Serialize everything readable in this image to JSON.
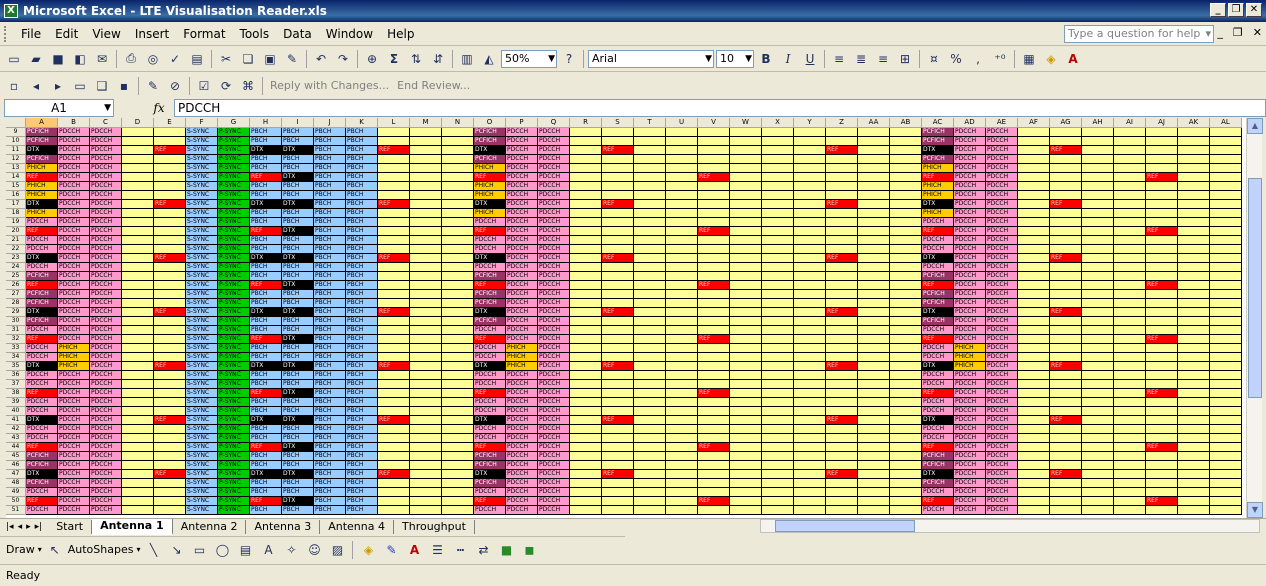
{
  "window": {
    "title": "Microsoft Excel - LTE Visualisation Reader.xls",
    "app_icon": "X",
    "minimize": "_",
    "restore": "❐",
    "close": "✕"
  },
  "menu": {
    "items": [
      "File",
      "Edit",
      "View",
      "Insert",
      "Format",
      "Tools",
      "Data",
      "Window",
      "Help"
    ],
    "help_placeholder": "Type a question for help",
    "doc_minimize": "_",
    "doc_restore": "❐",
    "doc_close": "✕"
  },
  "toolbar": {
    "zoom": "50%",
    "font": "Arial",
    "font_size": "10",
    "bold": "B",
    "italic": "I",
    "underline": "U",
    "sum_symbol": "Σ",
    "percent": "%",
    "comma": ",",
    "reply_changes": "Reply with Changes...",
    "end_review": "End Review..."
  },
  "formula_bar": {
    "name_box": "A1",
    "fx": "fx",
    "content": "PDCCH"
  },
  "columns": [
    "A",
    "B",
    "C",
    "D",
    "E",
    "F",
    "G",
    "H",
    "I",
    "J",
    "K",
    "L",
    "M",
    "N",
    "O",
    "P",
    "Q",
    "R",
    "S",
    "T",
    "U",
    "V",
    "W",
    "X",
    "Y",
    "Z",
    "AA",
    "AB",
    "AC",
    "AD",
    "AE",
    "AF",
    "AG",
    "AH",
    "AI",
    "AJ",
    "AK",
    "AL"
  ],
  "selected_column": "A",
  "rows": [
    {
      "n": "9",
      "a": "PCFICH",
      "h": "PBCH",
      "i": "PBCH"
    },
    {
      "n": "10",
      "a": "PCFICH",
      "h": "PBCH",
      "i": "PBCH"
    },
    {
      "n": "11",
      "a": "DTX",
      "h": "DTX",
      "i": "DTX",
      "ref": [
        "E",
        "L",
        "S",
        "Z",
        "AG"
      ]
    },
    {
      "n": "12",
      "a": "PCFICH",
      "h": "PBCH",
      "i": "PBCH"
    },
    {
      "n": "13",
      "a": "PHICH",
      "h": "PBCH",
      "i": "PBCH"
    },
    {
      "n": "14",
      "a": "REF",
      "h": "REF",
      "i": "DTX",
      "ref": [
        "V",
        "AJ"
      ]
    },
    {
      "n": "15",
      "a": "PHICH",
      "h": "PBCH",
      "i": "PBCH"
    },
    {
      "n": "16",
      "a": "PHICH",
      "h": "PBCH",
      "i": "PBCH"
    },
    {
      "n": "17",
      "a": "DTX",
      "h": "DTX",
      "i": "DTX",
      "ref": [
        "E",
        "L",
        "S",
        "Z",
        "AG"
      ]
    },
    {
      "n": "18",
      "a": "PHICH",
      "h": "PBCH",
      "i": "PBCH"
    },
    {
      "n": "19",
      "a": "PDCCH",
      "h": "PBCH",
      "i": "PBCH"
    },
    {
      "n": "20",
      "a": "REF",
      "h": "REF",
      "i": "DTX",
      "ref": [
        "V",
        "AJ"
      ]
    },
    {
      "n": "21",
      "a": "PDCCH",
      "h": "PBCH",
      "i": "PBCH"
    },
    {
      "n": "22",
      "a": "PDCCH",
      "h": "PBCH",
      "i": "PBCH"
    },
    {
      "n": "23",
      "a": "DTX",
      "h": "DTX",
      "i": "DTX",
      "ref": [
        "E",
        "L",
        "S",
        "Z",
        "AG"
      ]
    },
    {
      "n": "24",
      "a": "PDCCH",
      "h": "PBCH",
      "i": "PBCH"
    },
    {
      "n": "25",
      "a": "PCFICH",
      "h": "PBCH",
      "i": "PBCH"
    },
    {
      "n": "26",
      "a": "REF",
      "h": "REF",
      "i": "DTX",
      "ref": [
        "V",
        "AJ"
      ]
    },
    {
      "n": "27",
      "a": "PCFICH",
      "h": "PBCH",
      "i": "PBCH"
    },
    {
      "n": "28",
      "a": "PCFICH",
      "h": "PBCH",
      "i": "PBCH"
    },
    {
      "n": "29",
      "a": "DTX",
      "h": "DTX",
      "i": "DTX",
      "ref": [
        "E",
        "L",
        "S",
        "Z",
        "AG"
      ]
    },
    {
      "n": "30",
      "a": "PCFICH",
      "h": "PBCH",
      "i": "PBCH"
    },
    {
      "n": "31",
      "a": "PDCCH",
      "h": "PBCH",
      "i": "PBCH"
    },
    {
      "n": "32",
      "a": "REF",
      "h": "REF",
      "i": "DTX",
      "ref": [
        "V",
        "AJ"
      ]
    },
    {
      "n": "33",
      "a": "PDCCH",
      "b": "PHICH",
      "h": "PBCH",
      "i": "PBCH"
    },
    {
      "n": "34",
      "a": "PDCCH",
      "b": "PHICH",
      "h": "PBCH",
      "i": "PBCH"
    },
    {
      "n": "35",
      "a": "DTX",
      "b": "PHICH",
      "h": "DTX",
      "i": "DTX",
      "ref": [
        "E",
        "L",
        "S",
        "Z",
        "AG"
      ]
    },
    {
      "n": "36",
      "a": "PDCCH",
      "h": "PBCH",
      "i": "PBCH"
    },
    {
      "n": "37",
      "a": "PDCCH",
      "h": "PBCH",
      "i": "PBCH"
    },
    {
      "n": "38",
      "a": "REF",
      "h": "REF",
      "i": "DTX",
      "ref": [
        "V",
        "AJ"
      ]
    },
    {
      "n": "39",
      "a": "PDCCH",
      "h": "PBCH",
      "i": "PBCH"
    },
    {
      "n": "40",
      "a": "PDCCH",
      "h": "PBCH",
      "i": "PBCH"
    },
    {
      "n": "41",
      "a": "DTX",
      "h": "DTX",
      "i": "DTX",
      "ref": [
        "E",
        "L",
        "S",
        "Z",
        "AG"
      ]
    },
    {
      "n": "42",
      "a": "PDCCH",
      "h": "PBCH",
      "i": "PBCH"
    },
    {
      "n": "43",
      "a": "PDCCH",
      "h": "PBCH",
      "i": "PBCH"
    },
    {
      "n": "44",
      "a": "REF",
      "h": "REF",
      "i": "DTX",
      "ref": [
        "V",
        "AJ"
      ]
    },
    {
      "n": "45",
      "a": "PCFICH",
      "h": "PBCH",
      "i": "PBCH"
    },
    {
      "n": "46",
      "a": "PCFICH",
      "h": "PBCH",
      "i": "PBCH"
    },
    {
      "n": "47",
      "a": "DTX",
      "h": "DTX",
      "i": "DTX",
      "ref": [
        "E",
        "L",
        "S",
        "Z",
        "AG"
      ]
    },
    {
      "n": "48",
      "a": "PCFICH",
      "h": "PBCH",
      "i": "PBCH"
    },
    {
      "n": "49",
      "a": "PDCCH",
      "h": "PBCH",
      "i": "PBCH"
    },
    {
      "n": "50",
      "a": "REF",
      "h": "REF",
      "i": "DTX",
      "ref": [
        "V",
        "AJ"
      ]
    },
    {
      "n": "51",
      "a": "PDCCH",
      "h": "PBCH",
      "i": "PBCH"
    }
  ],
  "labels": {
    "pdcch": "PDCCH",
    "ssync": "S-SYNC",
    "psync": "P-SYNC",
    "pbch": "PBCH",
    "ref": "REF"
  },
  "colors": {
    "PCFICH": "#993366",
    "PHICH": "#ffcc00",
    "PDCCH": "#ff99cc",
    "DTX": "#000000",
    "REF": "#ff0000",
    "PBCH": "#99ccff",
    "S-SYNC": "#99ccff",
    "P-SYNC": "#00cc00",
    "empty": "#ffff99"
  },
  "sheet_tabs": [
    "Start",
    "Antenna 1",
    "Antenna 2",
    "Antenna 3",
    "Antenna 4",
    "Throughput"
  ],
  "active_tab": "Antenna 1",
  "drawing": {
    "draw": "Draw",
    "autoshapes": "AutoShapes"
  },
  "status": "Ready"
}
